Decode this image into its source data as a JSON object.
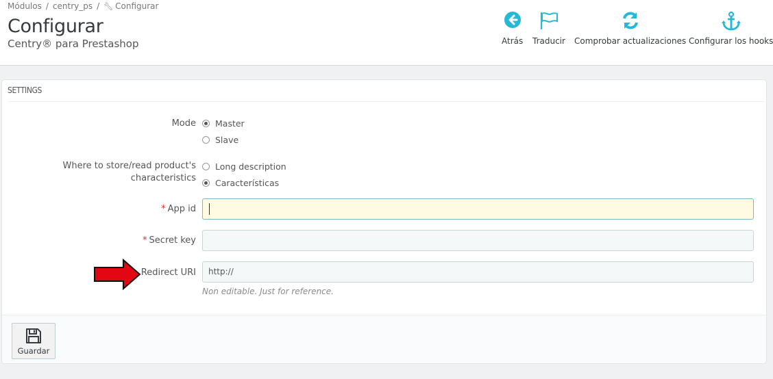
{
  "breadcrumb": {
    "items": [
      "Módulos",
      "centry_ps",
      "Configurar"
    ],
    "separator": "/"
  },
  "header": {
    "title": "Configurar",
    "subtitle": "Centry® para Prestashop"
  },
  "toolbar": {
    "back_label": "Atrás",
    "translate_label": "Traducir",
    "check_updates_label": "Comprobar actualizaciones",
    "hooks_label": "Configurar los hooks",
    "icon_color": "#25b9d7"
  },
  "panel": {
    "heading": "SETTINGS",
    "mode": {
      "label": "Mode",
      "options": [
        "Master",
        "Slave"
      ],
      "selected": "Master"
    },
    "characteristics": {
      "label_line1": "Where to store/read product's",
      "label_line2": "characteristics",
      "options": [
        "Long description",
        "Características"
      ],
      "selected": "Características"
    },
    "app_id": {
      "label": "App id",
      "required_mark": "*",
      "value": ""
    },
    "secret_key": {
      "label": "Secret key",
      "required_mark": "*",
      "value": ""
    },
    "redirect_uri": {
      "label": "Redirect URI",
      "value": "http://",
      "help": "Non editable. Just for reference."
    },
    "annotation_arrow_color": "#e30613"
  },
  "footer": {
    "save_label": "Guardar"
  }
}
